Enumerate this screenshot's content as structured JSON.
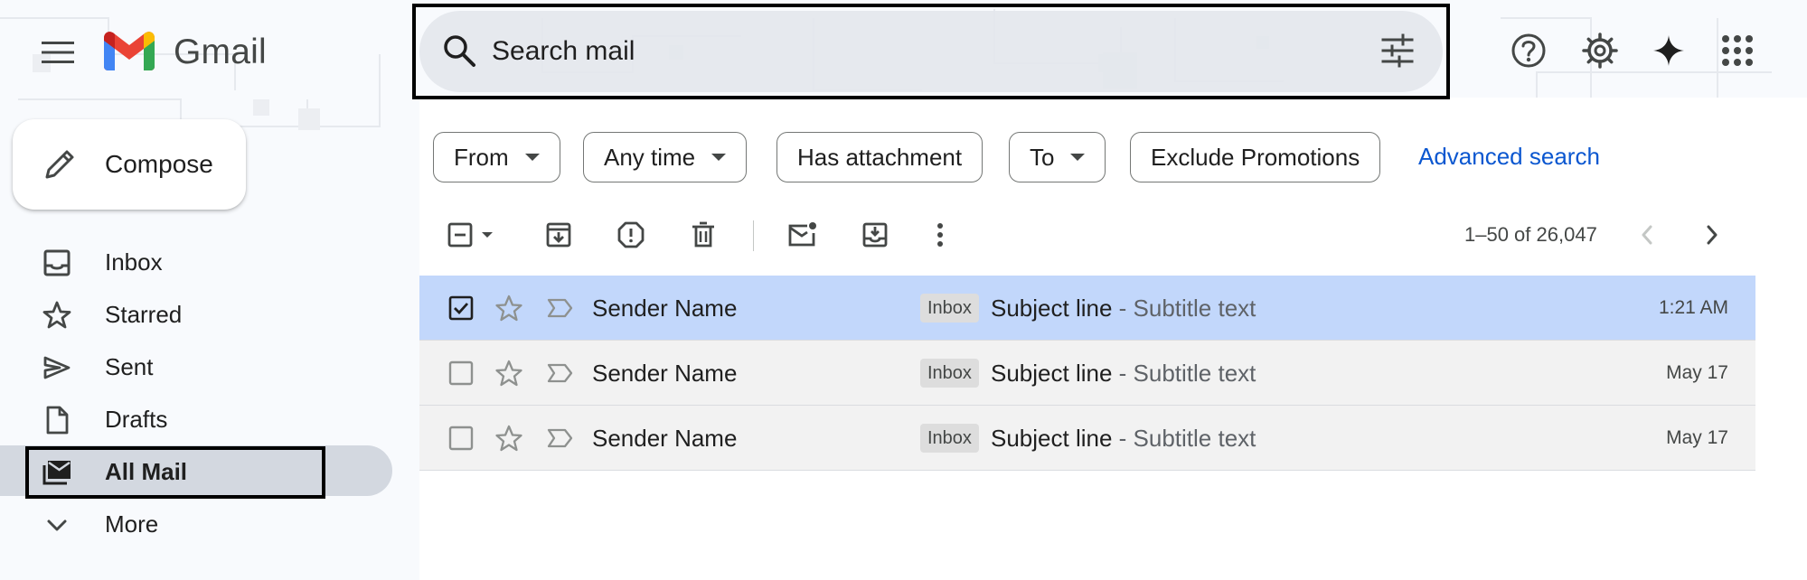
{
  "header": {
    "app_name": "Gmail",
    "search_placeholder": "Search mail",
    "icons": [
      "menu-icon",
      "gmail-logo",
      "search-icon",
      "search-options-icon",
      "help-icon",
      "settings-icon",
      "gemini-sparkle-icon",
      "apps-grid-icon"
    ]
  },
  "sidebar": {
    "compose_label": "Compose",
    "items": [
      {
        "label": "Inbox",
        "icon": "inbox-icon",
        "active": false
      },
      {
        "label": "Starred",
        "icon": "star-icon",
        "active": false
      },
      {
        "label": "Sent",
        "icon": "send-icon",
        "active": false
      },
      {
        "label": "Drafts",
        "icon": "draft-icon",
        "active": false
      },
      {
        "label": "All Mail",
        "icon": "all-mail-icon",
        "active": true
      },
      {
        "label": "More",
        "icon": "chevron-down-icon",
        "active": false
      }
    ]
  },
  "filters": {
    "chips": [
      {
        "label": "From",
        "dropdown": true
      },
      {
        "label": "Any time",
        "dropdown": true
      },
      {
        "label": "Has attachment",
        "dropdown": false
      },
      {
        "label": "To",
        "dropdown": true
      },
      {
        "label": "Exclude Promotions",
        "dropdown": false
      }
    ],
    "advanced_search": "Advanced search"
  },
  "toolbar": {
    "icons": [
      "select-checkbox-icon",
      "archive-icon",
      "report-spam-icon",
      "delete-icon",
      "mark-unread-icon",
      "move-to-inbox-icon",
      "more-vert-icon"
    ],
    "pagination": "1–50 of 26,047"
  },
  "emails": [
    {
      "sender": "Sender Name",
      "label": "Inbox",
      "subject": "Subject line",
      "separator": " - ",
      "subtitle": "Subtitle text",
      "date": "1:21 AM",
      "selected": true
    },
    {
      "sender": "Sender Name",
      "label": "Inbox",
      "subject": "Subject line",
      "separator": " - ",
      "subtitle": "Subtitle text",
      "date": "May 17",
      "selected": false
    },
    {
      "sender": "Sender Name",
      "label": "Inbox",
      "subject": "Subject line",
      "separator": " - ",
      "subtitle": "Subtitle text",
      "date": "May 17",
      "selected": false
    }
  ],
  "colors": {
    "selected_row": "#c2d7fb",
    "read_row": "#f2f2f2",
    "link": "#0b57d0",
    "nav_active": "#d3d8e0"
  }
}
